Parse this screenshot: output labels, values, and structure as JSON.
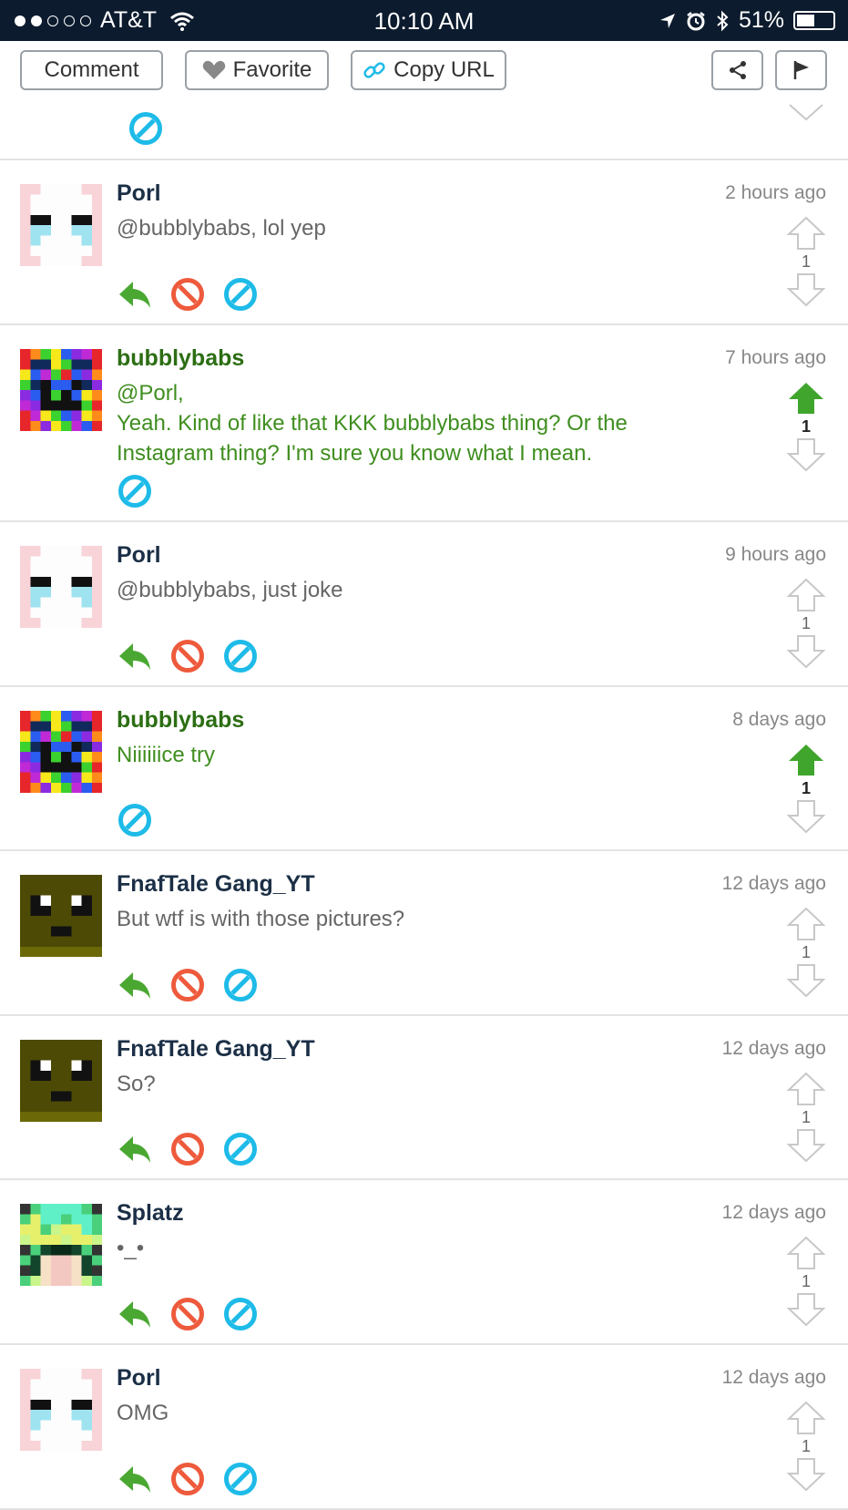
{
  "status_bar": {
    "carrier": "AT&T",
    "time": "10:10 AM",
    "battery": "51%",
    "battery_level": 0.51
  },
  "toolbar": {
    "comment_label": "Comment",
    "favorite_label": "Favorite",
    "copy_url_label": "Copy URL"
  },
  "comments": [
    {
      "name": "Porl",
      "time": "2 hours ago",
      "text": "@bubblybabs, lol yep",
      "votes": "1",
      "upvoted": false,
      "own": false
    },
    {
      "name": "bubblybabs",
      "time": "7 hours ago",
      "text": "@Porl,\nYeah. Kind of like that KKK bubblybabs thing? Or the Instagram thing? I'm sure you know what I mean.",
      "votes": "1",
      "upvoted": true,
      "own": true
    },
    {
      "name": "Porl",
      "time": "9 hours ago",
      "text": "@bubblybabs, just joke",
      "votes": "1",
      "upvoted": false,
      "own": false
    },
    {
      "name": "bubblybabs",
      "time": "8 days ago",
      "text": "Niiiiiice try",
      "votes": "1",
      "upvoted": true,
      "own": true
    },
    {
      "name": "FnafTale Gang_YT",
      "time": "12 days ago",
      "text": "But wtf is with those pictures?",
      "votes": "1",
      "upvoted": false,
      "own": false
    },
    {
      "name": "FnafTale Gang_YT",
      "time": "12 days ago",
      "text": "So?",
      "votes": "1",
      "upvoted": false,
      "own": false
    },
    {
      "name": "Splatz",
      "time": "12 days ago",
      "text": "•_•",
      "votes": "1",
      "upvoted": false,
      "own": false
    },
    {
      "name": "Porl",
      "time": "12 days ago",
      "text": "OMG",
      "votes": "1",
      "upvoted": false,
      "own": false
    }
  ],
  "icons": {
    "reply": "reply-arrow-icon",
    "report": "red-block-icon",
    "block": "blue-block-icon",
    "up": "up-arrow-icon",
    "down": "down-arrow-icon"
  },
  "colors": {
    "status_bg": "#0c1b2e",
    "green": "#4aa832",
    "red": "#ee5a3c",
    "blue": "#1ebbe8"
  }
}
